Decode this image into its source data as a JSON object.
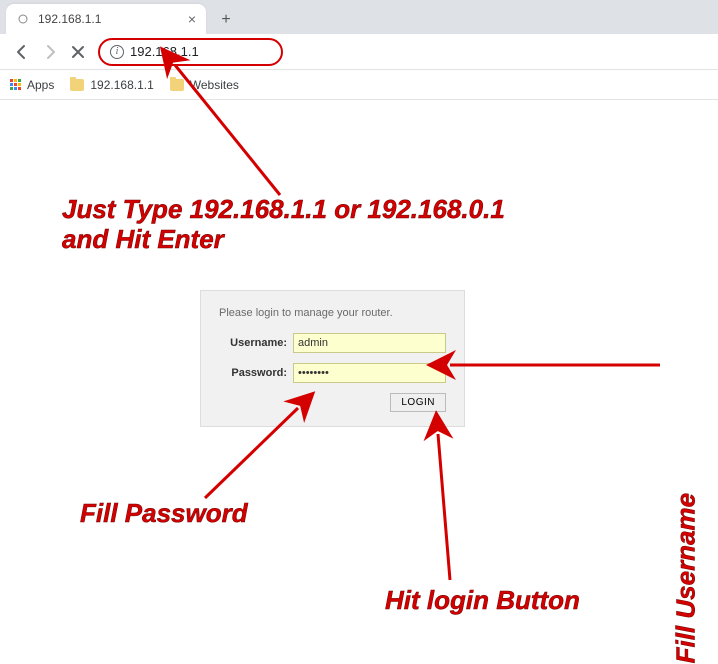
{
  "browser": {
    "tab_title": "192.168.1.1",
    "url_text": "192.168.1.1",
    "newtab_label": "+",
    "apps_label": "Apps",
    "bookmarks": [
      {
        "label": "192.168.1.1"
      },
      {
        "label": "Websites"
      }
    ]
  },
  "router": {
    "prompt": "Please login to manage your router.",
    "username_label": "Username:",
    "username_value": "admin",
    "password_label": "Password:",
    "password_value": "••••••••",
    "login_button": "LOGIN"
  },
  "annotations": {
    "url_tip": "Just Type 192.168.1.1 or 192.168.0.1\nand Hit Enter",
    "fill_username": "Fill Username",
    "fill_password": "Fill Password",
    "hit_login": "Hit login Button"
  }
}
